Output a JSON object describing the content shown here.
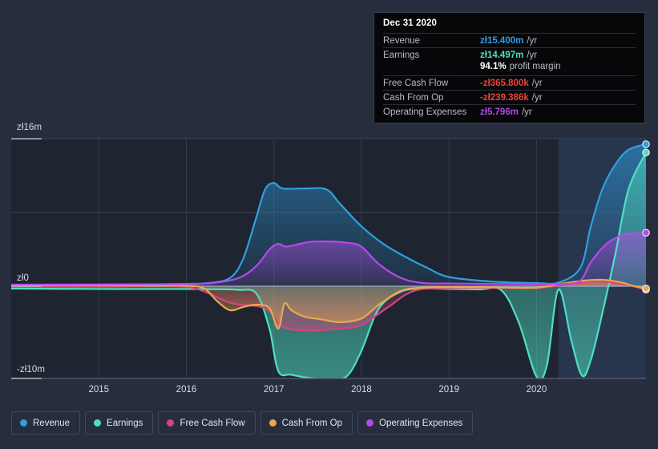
{
  "chart_data": {
    "type": "area",
    "title": "",
    "xlabel": "",
    "ylabel": "",
    "currency_symbol": "zł",
    "grid": true,
    "legend_position": "bottom",
    "xlim": [
      2014.0,
      2021.25
    ],
    "ylim": [
      -10,
      16
    ],
    "x_ticks": [
      "2015",
      "2016",
      "2017",
      "2018",
      "2019",
      "2020"
    ],
    "x_tick_values": [
      2015,
      2016,
      2017,
      2018,
      2019,
      2020
    ],
    "y_ticks": [
      "zł16m",
      "zł0",
      "-zł10m"
    ],
    "y_tick_values": [
      16,
      0,
      -10
    ],
    "gridline_values": [
      16,
      8,
      0,
      -10
    ],
    "highlight_band": {
      "from": 2020.25,
      "to": 2021.25,
      "label": "forecast-region"
    },
    "series": [
      {
        "name": "Revenue",
        "color": "#2f9fe0",
        "end_value": 15.4,
        "x": [
          2014.0,
          2014.5,
          2015.0,
          2015.5,
          2016.0,
          2016.25,
          2016.5,
          2016.65,
          2016.8,
          2016.9,
          2017.0,
          2017.1,
          2017.35,
          2017.6,
          2017.75,
          2018.0,
          2018.25,
          2018.5,
          2018.75,
          2019.0,
          2019.5,
          2020.0,
          2020.25,
          2020.5,
          2020.62,
          2020.75,
          2020.9,
          2021.05,
          2021.25
        ],
        "y": [
          0.12,
          0.15,
          0.18,
          0.2,
          0.25,
          0.35,
          0.9,
          3.0,
          7.5,
          10.5,
          11.2,
          10.6,
          10.6,
          10.5,
          9.0,
          6.5,
          4.6,
          3.2,
          2.0,
          1.0,
          0.5,
          0.35,
          0.4,
          2.0,
          6.5,
          10.5,
          13.2,
          14.8,
          15.4
        ]
      },
      {
        "name": "Earnings",
        "color": "#4fdfc2",
        "end_value": 14.497,
        "x": [
          2014.0,
          2015.0,
          2015.8,
          2016.0,
          2016.3,
          2016.6,
          2016.8,
          2016.95,
          2017.05,
          2017.2,
          2017.45,
          2017.7,
          2017.85,
          2018.0,
          2018.2,
          2018.45,
          2018.7,
          2019.0,
          2019.35,
          2019.6,
          2019.8,
          2020.0,
          2020.12,
          2020.25,
          2020.4,
          2020.52,
          2020.62,
          2020.75,
          2020.9,
          2021.05,
          2021.25
        ],
        "y": [
          -0.25,
          -0.3,
          -0.3,
          -0.3,
          -0.32,
          -0.4,
          -0.8,
          -4.6,
          -9.2,
          -9.6,
          -10.0,
          -10.1,
          -9.6,
          -7.0,
          -2.4,
          -0.6,
          -0.25,
          -0.3,
          -0.35,
          -0.45,
          -4.0,
          -9.8,
          -8.5,
          -0.35,
          -6.0,
          -9.7,
          -8.0,
          -3.0,
          3.5,
          10.5,
          14.5
        ]
      },
      {
        "name": "Free Cash Flow",
        "color": "#d6437d",
        "end_value": -0.3658,
        "x": [
          2014.0,
          2015.0,
          2016.0,
          2016.5,
          2016.9,
          2017.1,
          2017.4,
          2017.75,
          2018.0,
          2018.3,
          2018.6,
          2019.0,
          2019.5,
          2020.0,
          2020.4,
          2020.7,
          2021.0,
          2021.25
        ],
        "y": [
          -0.05,
          -0.06,
          -0.08,
          -1.8,
          -2.4,
          -4.4,
          -4.8,
          -4.6,
          -4.2,
          -2.3,
          -0.5,
          -0.2,
          -0.18,
          -0.2,
          0.25,
          0.55,
          0.2,
          -0.37
        ]
      },
      {
        "name": "Cash From Op",
        "color": "#e9a84f",
        "end_value": -0.239386,
        "x": [
          2014.0,
          2014.6,
          2015.2,
          2015.7,
          2016.0,
          2016.2,
          2016.35,
          2016.5,
          2016.65,
          2016.8,
          2016.95,
          2017.05,
          2017.12,
          2017.2,
          2017.35,
          2017.55,
          2017.75,
          2018.0,
          2018.2,
          2018.45,
          2018.7,
          2019.0,
          2019.5,
          2020.0,
          2020.3,
          2020.55,
          2020.75,
          2020.95,
          2021.1,
          2021.25
        ],
        "y": [
          0.1,
          0.12,
          0.08,
          0.06,
          0.05,
          -0.2,
          -1.6,
          -2.6,
          -2.25,
          -2.0,
          -2.4,
          -4.6,
          -1.9,
          -2.6,
          -3.3,
          -3.6,
          -3.9,
          -3.5,
          -2.0,
          -0.5,
          -0.15,
          -0.1,
          -0.12,
          -0.15,
          0.3,
          0.62,
          0.7,
          0.45,
          0.05,
          -0.24
        ]
      },
      {
        "name": "Operating Expenses",
        "color": "#b44ae8",
        "end_value": 5.796,
        "x": [
          2014.0,
          2015.0,
          2015.8,
          2016.0,
          2016.3,
          2016.6,
          2016.8,
          2016.95,
          2017.05,
          2017.15,
          2017.4,
          2017.65,
          2017.85,
          2018.0,
          2018.2,
          2018.45,
          2018.7,
          2019.0,
          2019.5,
          2020.0,
          2020.3,
          2020.5,
          2020.62,
          2020.8,
          2021.0,
          2021.25
        ],
        "y": [
          0.18,
          0.2,
          0.22,
          0.25,
          0.35,
          0.9,
          2.2,
          4.0,
          4.6,
          4.3,
          4.8,
          4.85,
          4.7,
          4.3,
          2.4,
          0.9,
          0.35,
          0.3,
          0.25,
          0.2,
          0.25,
          0.6,
          2.6,
          4.6,
          5.6,
          5.8
        ]
      }
    ]
  },
  "tooltip": {
    "date": "Dec 31 2020",
    "rows": [
      {
        "label": "Revenue",
        "value": "zł15.400m",
        "unit": "/yr",
        "color": "#2f9fe0"
      },
      {
        "label": "Earnings",
        "value": "zł14.497m",
        "unit": "/yr",
        "color": "#4fdfc2"
      },
      {
        "label": "",
        "value": "94.1%",
        "unit": "profit margin",
        "color": "#ffffff"
      },
      {
        "label": "Free Cash Flow",
        "value": "-zł365.800k",
        "unit": "/yr",
        "color": "#e8453c"
      },
      {
        "label": "Cash From Op",
        "value": "-zł239.386k",
        "unit": "/yr",
        "color": "#e8453c"
      },
      {
        "label": "Operating Expenses",
        "value": "zł5.796m",
        "unit": "/yr",
        "color": "#b44ae8"
      }
    ]
  },
  "legend": {
    "items": [
      {
        "label": "Revenue",
        "color": "#2f9fe0"
      },
      {
        "label": "Earnings",
        "color": "#4fdfc2"
      },
      {
        "label": "Free Cash Flow",
        "color": "#d6437d"
      },
      {
        "label": "Cash From Op",
        "color": "#e9a84f"
      },
      {
        "label": "Operating Expenses",
        "color": "#b44ae8"
      }
    ]
  },
  "axes": {
    "y_top": "zł16m",
    "y_zero": "zł0",
    "y_bottom": "-zł10m"
  }
}
